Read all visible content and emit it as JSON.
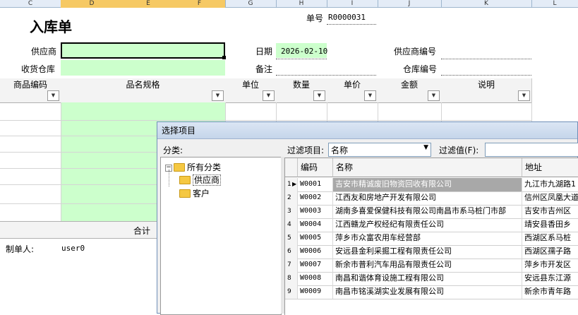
{
  "sheet": {
    "columns": [
      "C",
      "D",
      "E",
      "F",
      "G",
      "H",
      "I",
      "J",
      "K",
      "L"
    ],
    "selected_columns": [
      "D",
      "E",
      "F"
    ]
  },
  "form": {
    "title": "入库单",
    "order_no_label": "单号",
    "order_no_value": "R0000031",
    "supplier_label": "供应商",
    "warehouse_label": "收货仓库",
    "date_label": "日期",
    "date_value": "2026-02-10",
    "remark_label": "备注",
    "supplier_code_label": "供应商编号",
    "warehouse_code_label": "仓库编号"
  },
  "table": {
    "headers": [
      "商品编码",
      "品名规格",
      "单位",
      "数量",
      "单价",
      "金额",
      "说明"
    ],
    "total_label": "合计",
    "maker_label": "制单人:",
    "maker_value": "user0"
  },
  "dialog": {
    "title": "选择项目",
    "category_label": "分类:",
    "filter_item_label": "过滤项目:",
    "filter_item_value": "名称",
    "filter_value_label": "过滤值(F):",
    "filter_value": "",
    "tree": {
      "root": "所有分类",
      "children": [
        "供应商",
        "客户"
      ],
      "selected": "供应商"
    },
    "grid": {
      "headers": [
        "编码",
        "名称",
        "地址"
      ],
      "rows": [
        {
          "no": "1",
          "code": "W0001",
          "name": "吉安市精诚废旧物资回收有限公司",
          "addr": "九江市九湖路1"
        },
        {
          "no": "2",
          "code": "W0002",
          "name": "江西友和房地产开发有限公司",
          "addr": "信州区凤凰大道"
        },
        {
          "no": "3",
          "code": "W0003",
          "name": "湖南多喜爱保健科技有限公司南昌市系马桩门市部",
          "addr": "吉安市吉州区"
        },
        {
          "no": "4",
          "code": "W0004",
          "name": "江西赣龙产权经纪有限责任公司",
          "addr": "靖安县香田乡"
        },
        {
          "no": "5",
          "code": "W0005",
          "name": "萍乡市众富农用车经营部",
          "addr": "西湖区系马桩"
        },
        {
          "no": "6",
          "code": "W0006",
          "name": "安远县金利采掘工程有限责任公司",
          "addr": "西湖区孺子路"
        },
        {
          "no": "7",
          "code": "W0007",
          "name": "新余市普利汽车用品有限责任公司",
          "addr": "萍乡市开发区"
        },
        {
          "no": "8",
          "code": "W0008",
          "name": "南昌和谐体育设施工程有限公司",
          "addr": "安远县东江源"
        },
        {
          "no": "9",
          "code": "W0009",
          "name": "南昌市铭溪湖实业发展有限公司",
          "addr": "新余市青年路"
        }
      ],
      "selected_row": "1"
    }
  },
  "colors": {
    "input_green": "#ccffcc",
    "selected_row": "#a8a8a8",
    "title_bar": "#c5d5ea"
  }
}
